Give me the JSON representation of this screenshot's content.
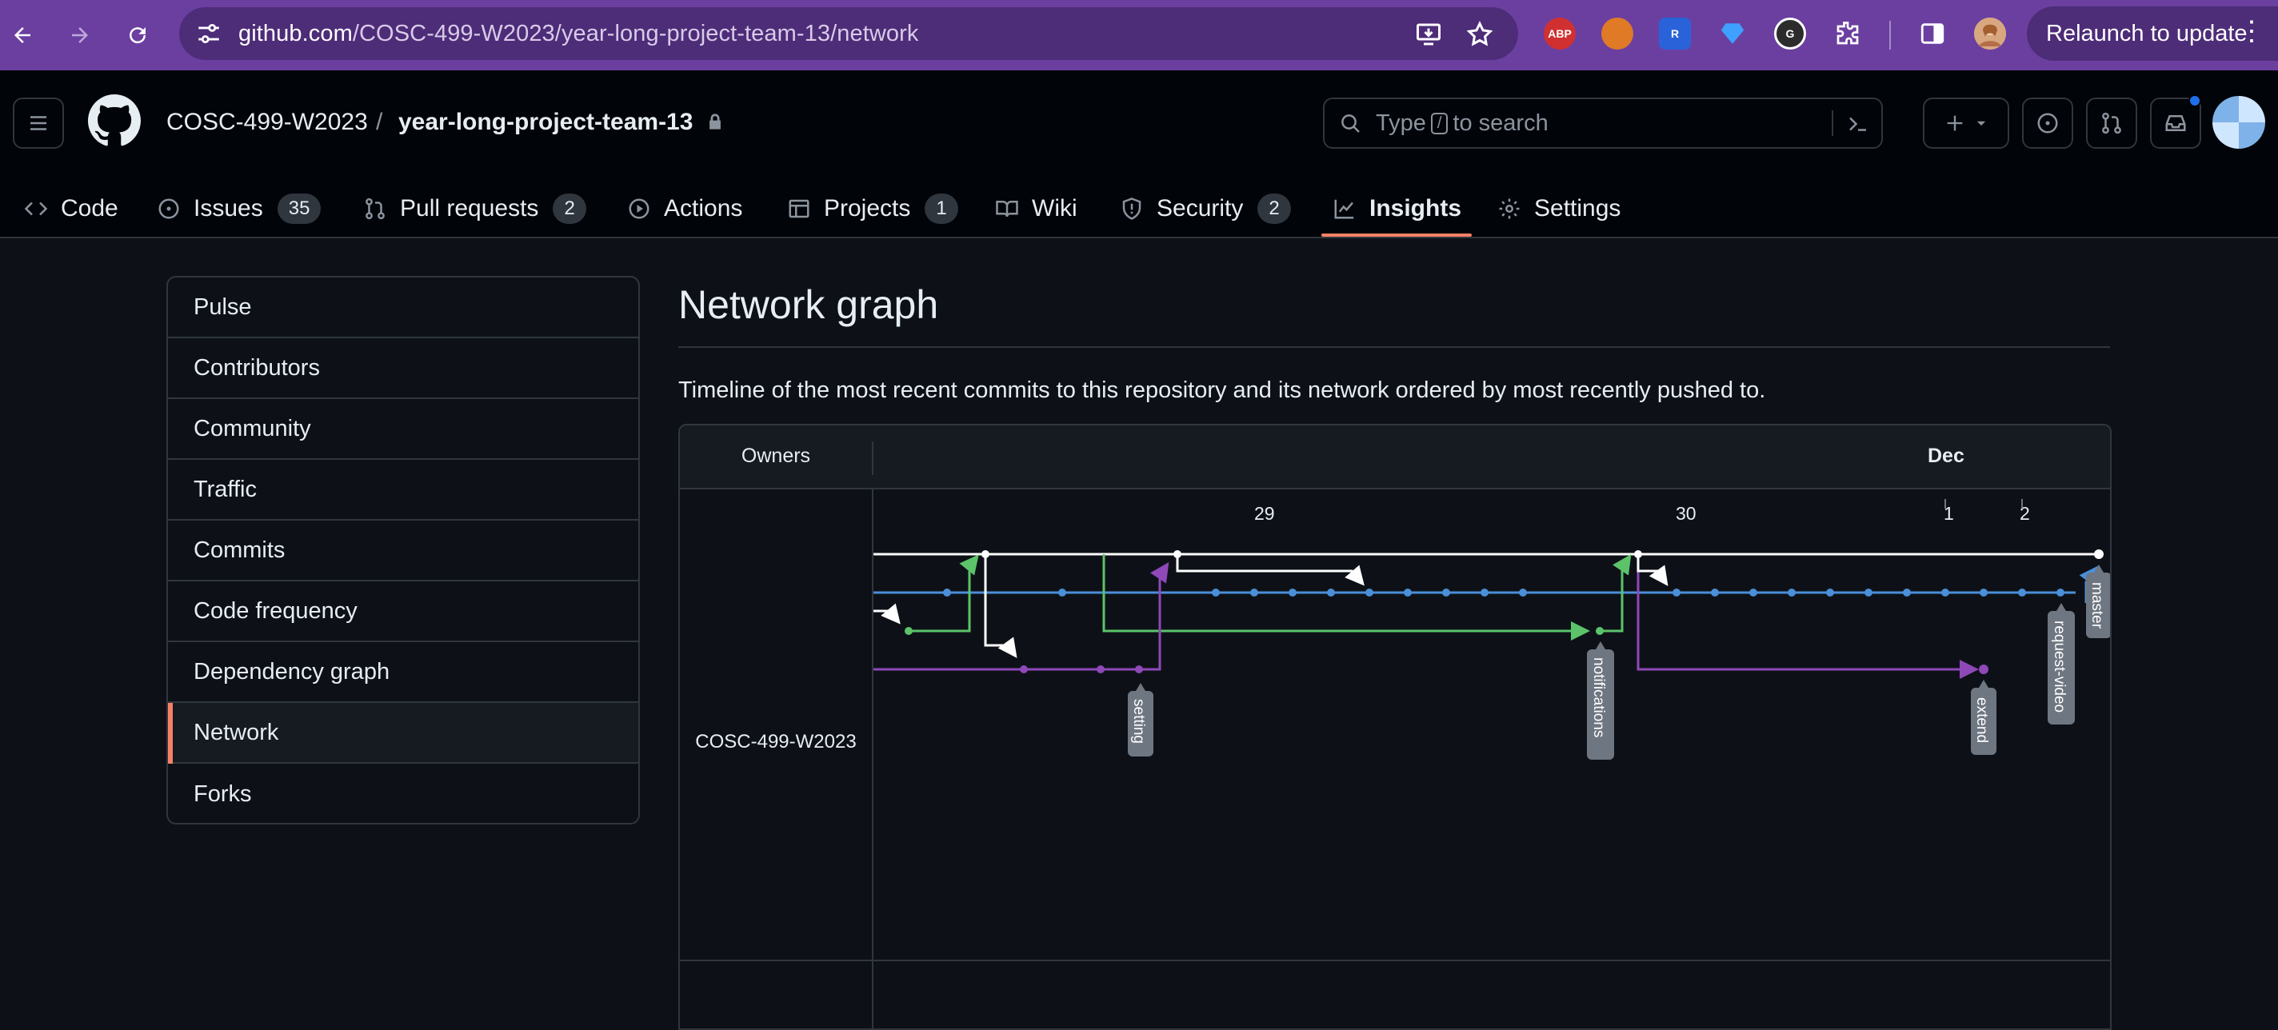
{
  "browser": {
    "url_host": "github.com",
    "url_path": "/COSC-499-W2023/year-long-project-team-13/network",
    "relaunch_label": "Relaunch to update",
    "extensions": [
      "ABP",
      "fox",
      "R",
      "gem",
      "G"
    ]
  },
  "header": {
    "owner": "COSC-499-W2023",
    "separator": "/",
    "repo": "year-long-project-team-13",
    "search_prefix": "Type",
    "search_key": "/",
    "search_suffix": "to search"
  },
  "tabs": [
    {
      "label": "Code"
    },
    {
      "label": "Issues",
      "count": "35"
    },
    {
      "label": "Pull requests",
      "count": "2"
    },
    {
      "label": "Actions"
    },
    {
      "label": "Projects",
      "count": "1"
    },
    {
      "label": "Wiki"
    },
    {
      "label": "Security",
      "count": "2"
    },
    {
      "label": "Insights",
      "active": true
    },
    {
      "label": "Settings"
    }
  ],
  "sidebar": {
    "items": [
      {
        "label": "Pulse"
      },
      {
        "label": "Contributors"
      },
      {
        "label": "Community"
      },
      {
        "label": "Traffic"
      },
      {
        "label": "Commits"
      },
      {
        "label": "Code frequency"
      },
      {
        "label": "Dependency graph"
      },
      {
        "label": "Network",
        "active": true
      },
      {
        "label": "Forks"
      }
    ]
  },
  "main": {
    "title": "Network graph",
    "description": "Timeline of the most recent commits to this repository and its network ordered by most recently pushed to."
  },
  "network": {
    "owners_header": "Owners",
    "month_label": "Dec",
    "owner_name": "COSC-499-W2023",
    "day_labels": [
      "29",
      "30",
      "1",
      "2"
    ],
    "branch_labels": [
      "setting",
      "notifications",
      "extend",
      "request-video",
      "master"
    ],
    "colors": {
      "master": "#ffffff",
      "main_blue": "#4a8fd8",
      "green": "#5cc36a",
      "purple": "#8f48b8",
      "label_bg": "#6e7681"
    }
  }
}
